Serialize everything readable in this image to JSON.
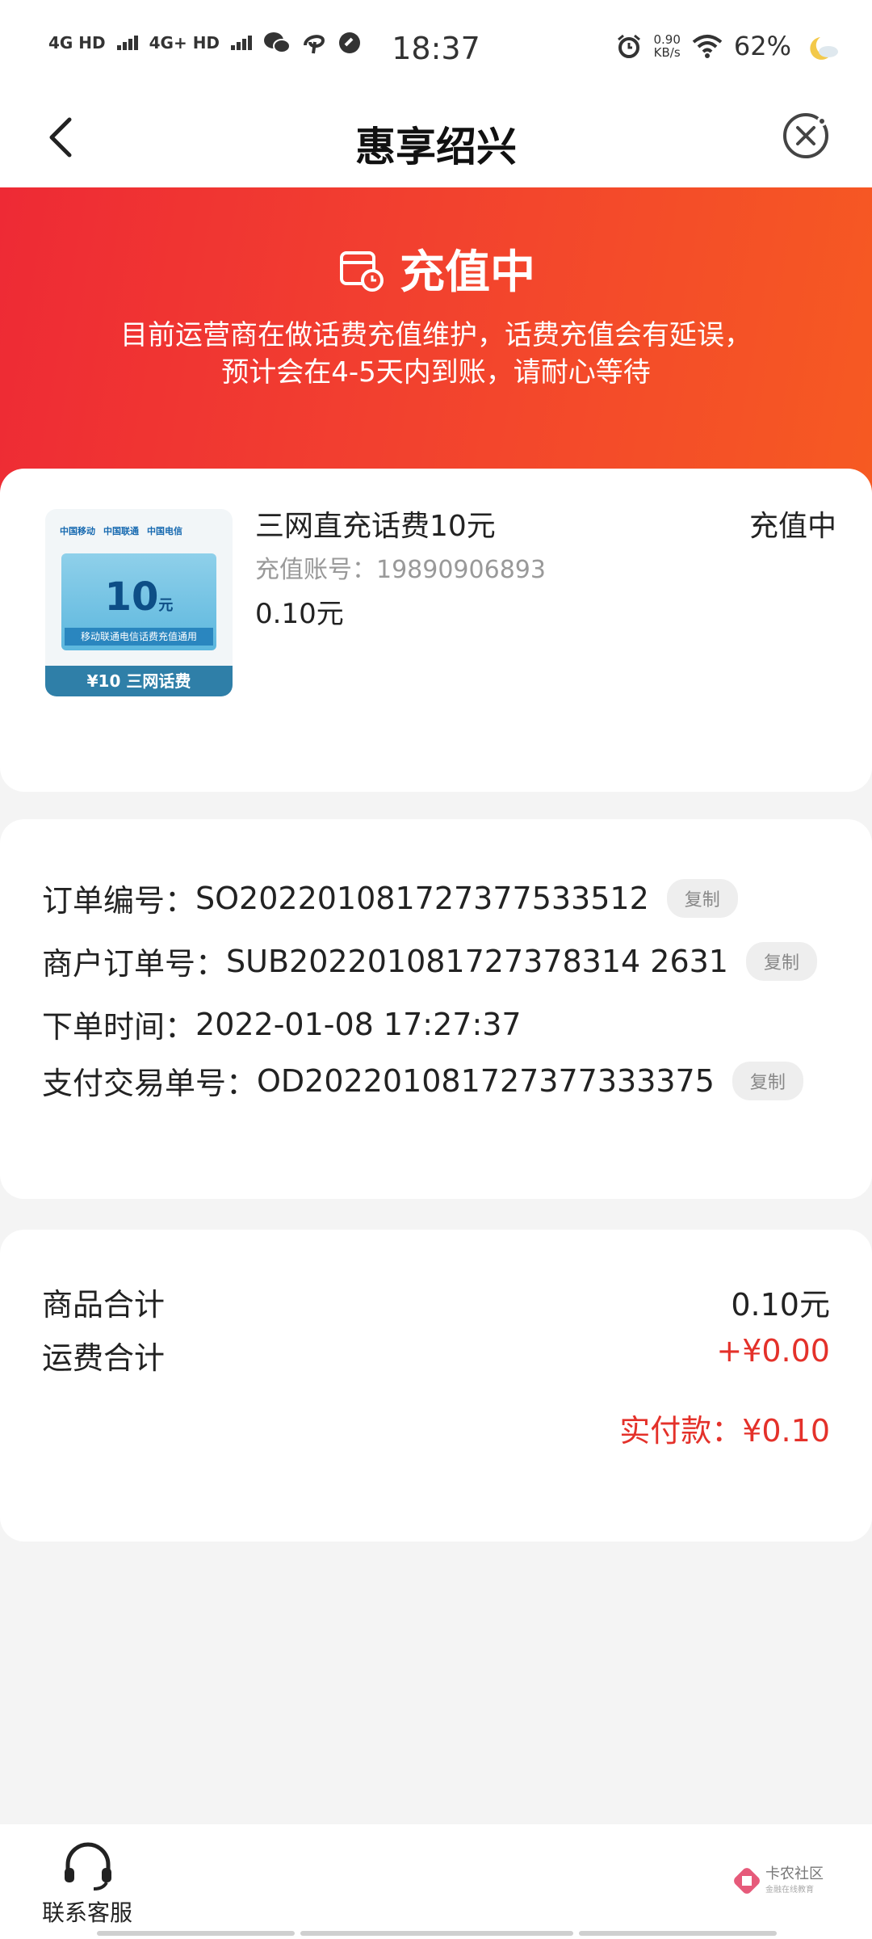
{
  "status_bar": {
    "network1": "4G HD",
    "network2": "4G+ HD",
    "time": "18:37",
    "speed_value": "0.90",
    "speed_unit": "KB/s",
    "battery": "62%"
  },
  "nav": {
    "title": "惠享绍兴"
  },
  "hero": {
    "title": "充值中",
    "message_line1": "目前运营商在做话费充值维护，话费充值会有延误，",
    "message_line2": "预计会在4-5天内到账，请耐心等待"
  },
  "product": {
    "image_logos": [
      "中国移动",
      "中国联通",
      "中国电信"
    ],
    "image_value": "10",
    "image_unit": "元",
    "image_strip": "移动联通电信话费充值通用",
    "image_bottom": "¥10 三网话费",
    "name": "三网直充话费10元",
    "status": "充值中",
    "account_label": "充值账号：",
    "account": "19890906893",
    "price": "0.10元"
  },
  "order": {
    "copy_label": "复制",
    "rows": [
      {
        "label": "订单编号：",
        "value": "SO202201081727377533512"
      },
      {
        "label": "商户订单号：",
        "value": "SUB202201081727378314 2631"
      },
      {
        "label": "下单时间：",
        "value": "2022-01-08 17:27:37"
      },
      {
        "label": "支付交易单号：",
        "value": "OD202201081727377333375"
      }
    ]
  },
  "totals": {
    "goods_label": "商品合计",
    "goods_value": "0.10元",
    "shipping_label": "运费合计",
    "shipping_value": "+¥0.00",
    "paid_label": "实付款：",
    "paid_value": "¥0.10"
  },
  "bottom": {
    "customer_service": "联系客服",
    "watermark": "卡农社区",
    "watermark_sub": "金融在线教育"
  },
  "colors": {
    "accent_red": "#e4312a",
    "hero_start": "#ee2a35",
    "hero_end": "#f65a22"
  }
}
